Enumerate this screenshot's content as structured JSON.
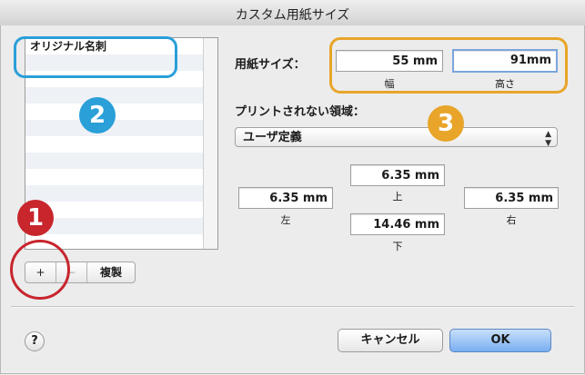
{
  "window": {
    "title": "カスタム用紙サイズ"
  },
  "list": {
    "items": [
      "オリジナル名刺",
      "",
      "",
      "",
      "",
      "",
      "",
      "",
      "",
      "",
      "",
      "",
      ""
    ]
  },
  "list_buttons": {
    "add": "+",
    "remove": "−",
    "duplicate": "複製"
  },
  "paper_size": {
    "label": "用紙サイズ：",
    "width_value": "55 mm",
    "width_caption": "幅",
    "height_value": "91mm",
    "height_caption": "高さ"
  },
  "margins": {
    "label": "プリントされない領域：",
    "preset_selected": "ユーザ定義",
    "top_value": "6.35 mm",
    "top_caption": "上",
    "left_value": "6.35 mm",
    "left_caption": "左",
    "right_value": "6.35 mm",
    "right_caption": "右",
    "bottom_value": "14.46 mm",
    "bottom_caption": "下"
  },
  "footer": {
    "help": "?",
    "cancel": "キャンセル",
    "ok": "OK"
  },
  "annotations": {
    "badge1": "1",
    "badge2": "2",
    "badge3": "3",
    "colors": {
      "red": "#c8252d",
      "blue": "#2a9fd8",
      "orange": "#e8a52a"
    }
  }
}
